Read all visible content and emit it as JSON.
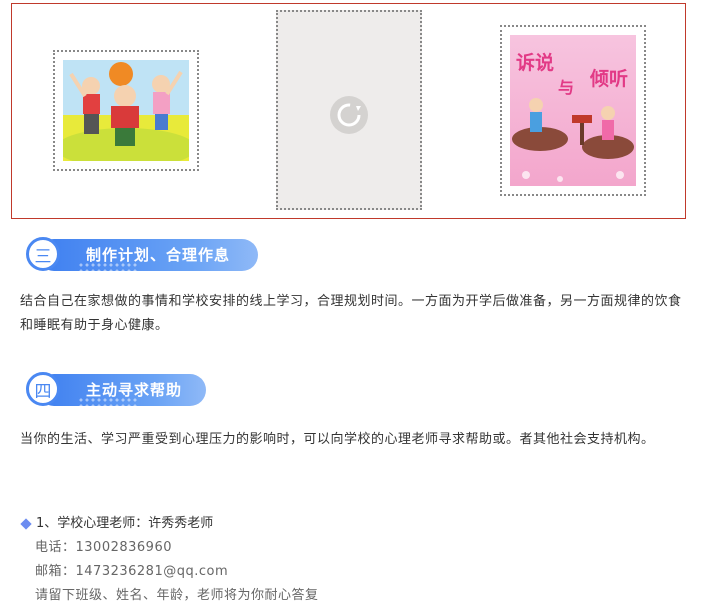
{
  "images": {
    "left": "children-cheering-illustration",
    "middle": "loading-placeholder",
    "right": {
      "art_title_1": "诉说",
      "art_connector": "与",
      "art_title_2": "倾听"
    }
  },
  "section3": {
    "number": "三",
    "title": "制作计划、合理作息",
    "body": "结合自己在家想做的事情和学校安排的线上学习，合理规划时间。一方面为开学后做准备，另一方面规律的饮食和睡眠有助于身心健康。"
  },
  "section4": {
    "number": "四",
    "title": "主动寻求帮助",
    "body": "当你的生活、学习严重受到心理压力的影响时，可以向学校的心理老师寻求帮助或。者其他社会支持机构。"
  },
  "contact": {
    "title": "1、学校心理老师：许秀秀老师",
    "phone": "电话：13002836960",
    "email": "邮箱：1473236281@qq.com",
    "note": "请留下班级、姓名、年龄，老师将为你耐心答复"
  },
  "colors": {
    "frame_border": "#c0392b",
    "header_blue": "#3e7ff0",
    "diamond": "#6c8cf0"
  }
}
